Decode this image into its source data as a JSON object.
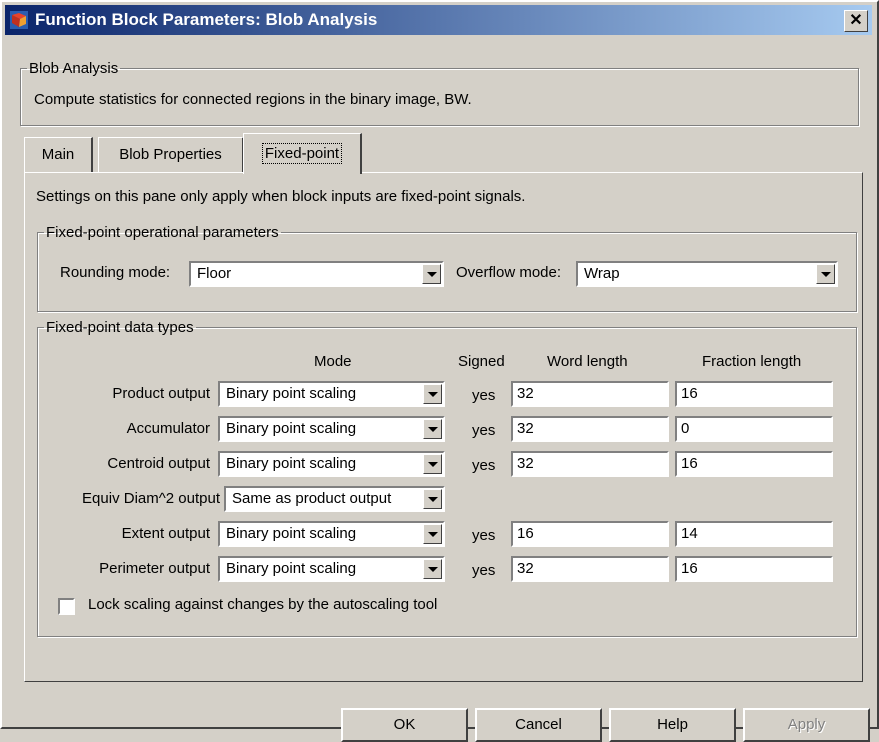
{
  "window": {
    "title": "Function Block Parameters: Blob Analysis"
  },
  "description_group": {
    "legend": "Blob Analysis",
    "text": "Compute statistics for connected regions in the binary image, BW."
  },
  "tabs": [
    {
      "label": "Main"
    },
    {
      "label": "Blob Properties"
    },
    {
      "label": "Fixed-point"
    }
  ],
  "panel": {
    "note": "Settings on this pane only apply when block inputs are fixed-point signals.",
    "op_params": {
      "legend": "Fixed-point operational parameters",
      "rounding_label": "Rounding mode:",
      "rounding_value": "Floor",
      "overflow_label": "Overflow mode:",
      "overflow_value": "Wrap"
    },
    "data_types": {
      "legend": "Fixed-point data types",
      "headers": {
        "mode": "Mode",
        "signed": "Signed",
        "word": "Word length",
        "fraction": "Fraction length"
      },
      "rows": [
        {
          "label": "Product output",
          "mode": "Binary point scaling",
          "signed": "yes",
          "word": "32",
          "fraction": "16"
        },
        {
          "label": "Accumulator",
          "mode": "Binary point scaling",
          "signed": "yes",
          "word": "32",
          "fraction": "0"
        },
        {
          "label": "Centroid output",
          "mode": "Binary point scaling",
          "signed": "yes",
          "word": "32",
          "fraction": "16"
        },
        {
          "label": "Equiv Diam^2 output",
          "mode": "Same as product output"
        },
        {
          "label": "Extent output",
          "mode": "Binary point scaling",
          "signed": "yes",
          "word": "16",
          "fraction": "14"
        },
        {
          "label": "Perimeter output",
          "mode": "Binary point scaling",
          "signed": "yes",
          "word": "32",
          "fraction": "16"
        }
      ],
      "lock_label": "Lock scaling against changes by the autoscaling tool",
      "lock_checked": false
    }
  },
  "buttons": {
    "ok": "OK",
    "cancel": "Cancel",
    "help": "Help",
    "apply": "Apply"
  }
}
